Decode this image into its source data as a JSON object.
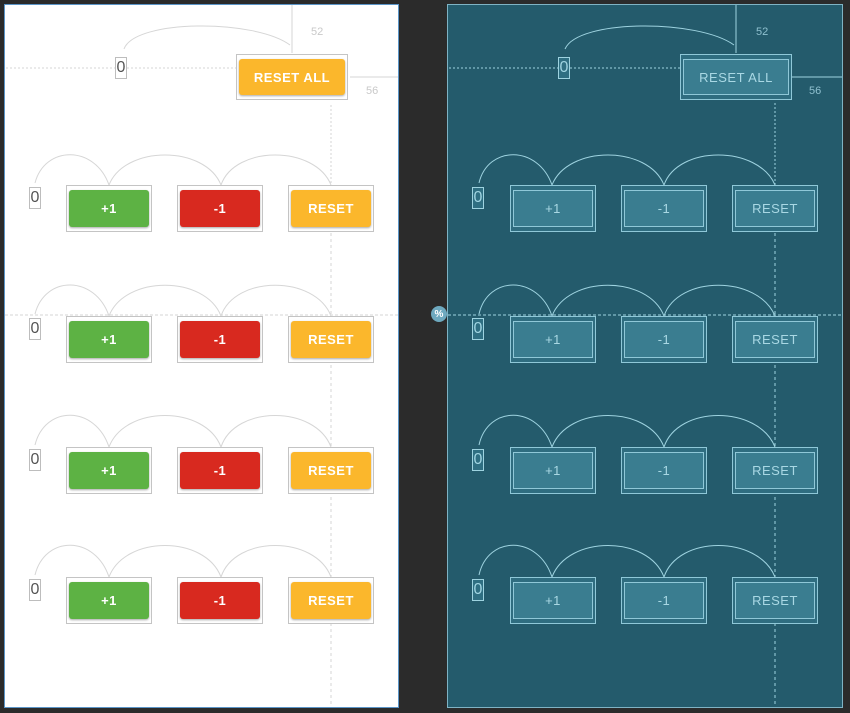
{
  "header": {
    "counter_value": "0",
    "reset_all_label": "RESET ALL",
    "margin_top": "52",
    "margin_end": "56"
  },
  "rows": [
    {
      "counter": "0",
      "plus": "+1",
      "minus": "-1",
      "reset": "RESET"
    },
    {
      "counter": "0",
      "plus": "+1",
      "minus": "-1",
      "reset": "RESET"
    },
    {
      "counter": "0",
      "plus": "+1",
      "minus": "-1",
      "reset": "RESET"
    },
    {
      "counter": "0",
      "plus": "+1",
      "minus": "-1",
      "reset": "RESET"
    }
  ],
  "guideline_badge": "%",
  "colors": {
    "plus": "#5db244",
    "minus": "#d8291f",
    "reset": "#fbb72c",
    "blueprint_bg": "#245b6c"
  }
}
